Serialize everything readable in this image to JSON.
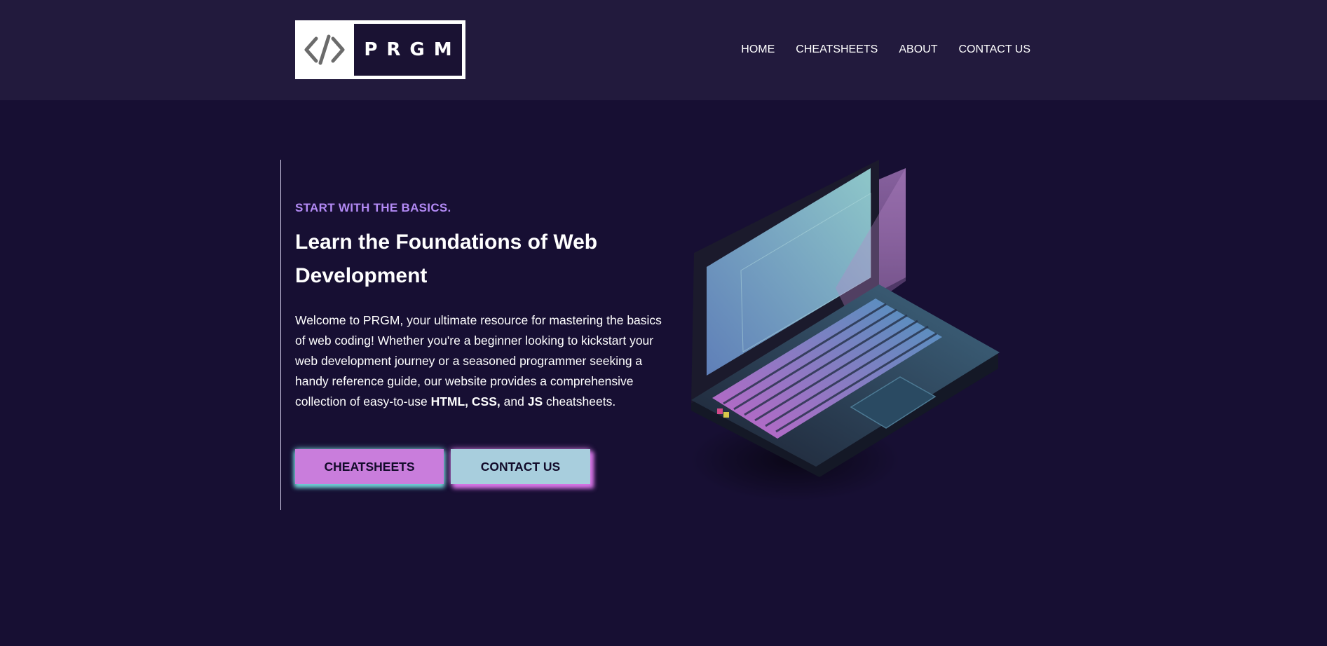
{
  "header": {
    "logo": {
      "mark": "</>",
      "wordmark": "PRGM"
    },
    "nav": [
      {
        "label": "HOME"
      },
      {
        "label": "CHEATSHEETS"
      },
      {
        "label": "ABOUT"
      },
      {
        "label": "CONTACT US"
      }
    ]
  },
  "hero": {
    "eyebrow": "START WITH THE BASICS.",
    "title": "Learn the Foundations of Web Development",
    "description": {
      "intro": "Welcome to PRGM, your ultimate resource for mastering the basics of web coding! Whether you're a beginner looking to kickstart your web development journey or a seasoned programmer seeking a handy reference guide, our website provides a comprehensive collection of easy-to-use ",
      "html": "HTML,",
      "css": "CSS,",
      "and": " and ",
      "js": "JS",
      "outro": " cheatsheets."
    },
    "buttons": {
      "primary": "CHEATSHEETS",
      "secondary": "CONTACT US"
    },
    "image": {
      "icon": "laptop-illustration"
    }
  },
  "colors": {
    "background": "#170f33",
    "header_bg": "#221a3d",
    "accent_purple": "#b38af5",
    "button_pink": "#c97ddc",
    "button_blue": "#a8cedd"
  }
}
